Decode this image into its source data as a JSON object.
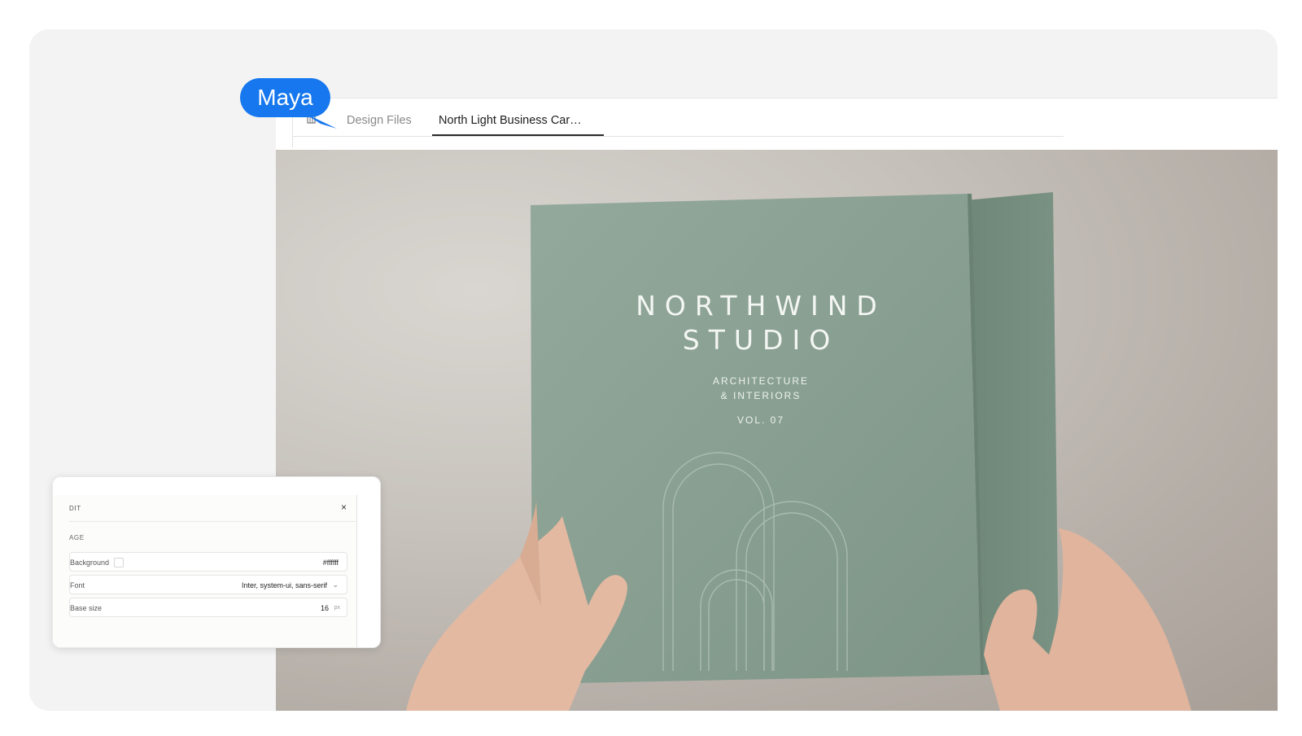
{
  "cursor": {
    "label": "Maya",
    "color": "#1677ee"
  },
  "tabs": [
    {
      "label": "Design Files",
      "active": false
    },
    {
      "label": "North Light Business Car…",
      "active": true
    }
  ],
  "cover": {
    "title_line1": "NORTHWIND",
    "title_line2": "STUDIO",
    "subtitle_line1": "ARCHITECTURE",
    "subtitle_line2": "& INTERIORS",
    "volume": "VOL. 07",
    "color": "#8aa193"
  },
  "panel": {
    "title": "DIT",
    "close_label": "×",
    "section": "AGE",
    "rows": [
      {
        "label": "Background",
        "value": "#ffffff"
      },
      {
        "label": "Font",
        "value": "Inter, system-ui, sans-serif"
      },
      {
        "label": "Base size",
        "value": "16",
        "unit": "px"
      }
    ]
  }
}
